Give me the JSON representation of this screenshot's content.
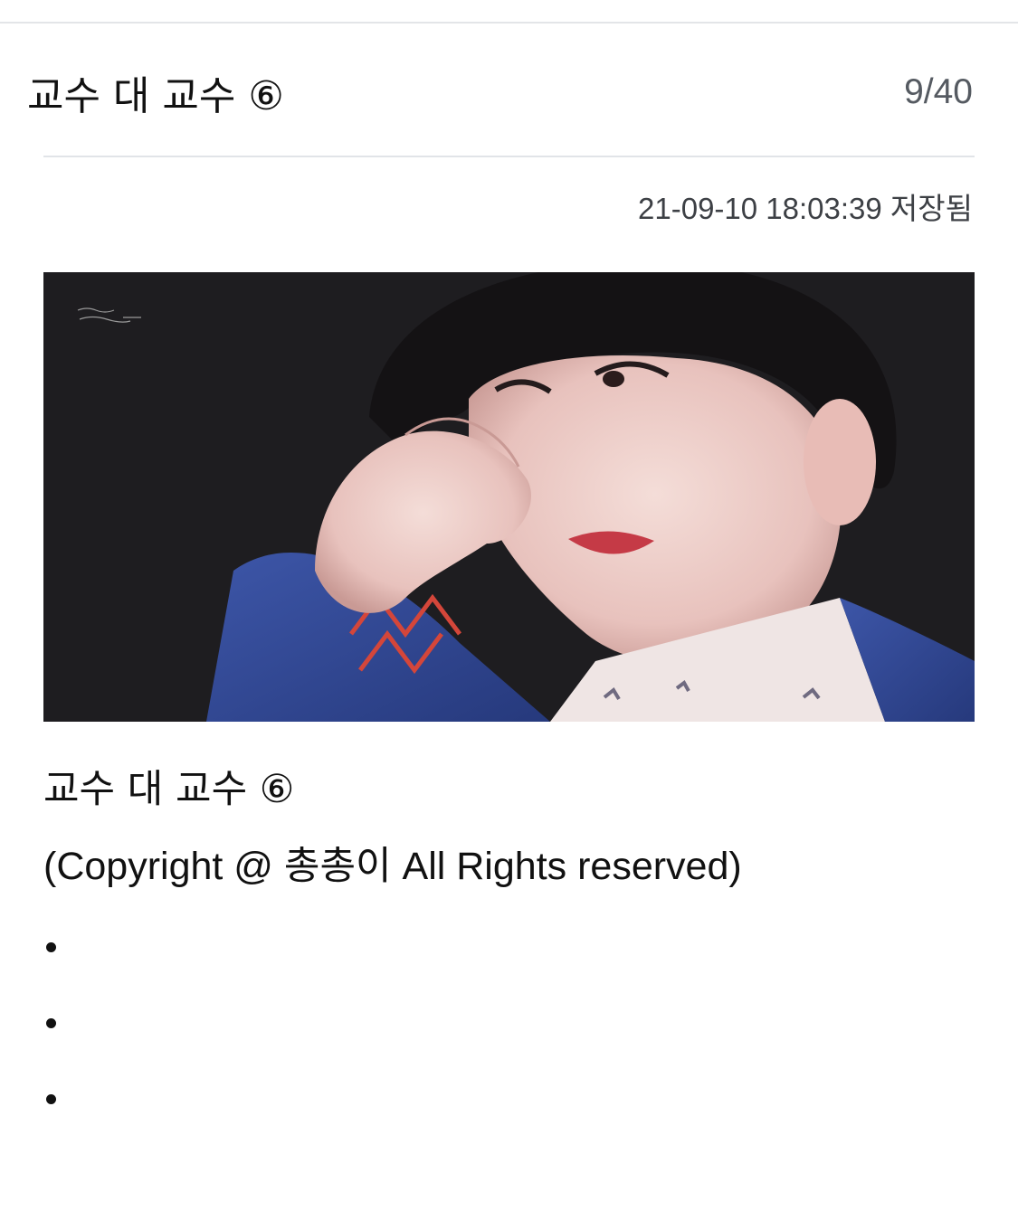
{
  "header": {
    "title": "교수 대 교수 ⑥",
    "page_counter": "9/40"
  },
  "meta": {
    "saved_time": "21-09-10 18:03:39 저장됨"
  },
  "content": {
    "hero_image": {
      "description_icon": "photo-person-wiping-eye"
    },
    "title": "교수 대 교수 ⑥",
    "copyright": "(Copyright @ 총총이 All Rights reserved)",
    "bullets": [
      "",
      "",
      ""
    ]
  },
  "colors": {
    "text": "#111111",
    "muted": "#555a61",
    "divider": "#e1e4e8",
    "image_bg": "#1d1c1f"
  }
}
